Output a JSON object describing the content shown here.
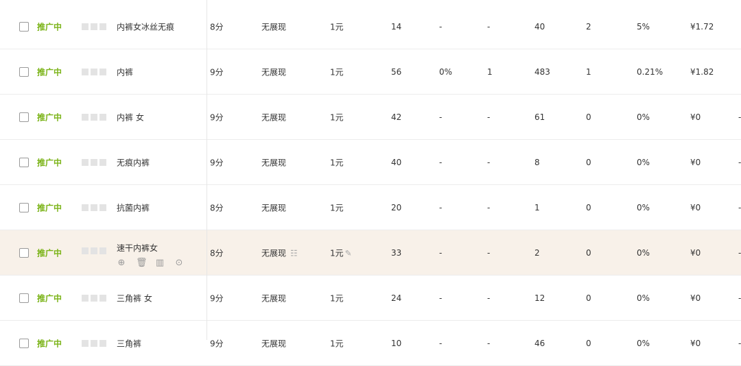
{
  "rows": [
    {
      "status": "推广中",
      "keyword": "内裤女冰丝无痕",
      "score": "8分",
      "show": "无展现",
      "bid": "1元",
      "rank": "14",
      "ctr": "-",
      "clicks": "-",
      "impressions": "40",
      "num": "2",
      "rate": "5%",
      "cost": "¥1.72",
      "extra": ""
    },
    {
      "status": "推广中",
      "keyword": "内裤",
      "score": "9分",
      "show": "无展现",
      "bid": "1元",
      "rank": "56",
      "ctr": "0%",
      "clicks": "1",
      "impressions": "483",
      "num": "1",
      "rate": "0.21%",
      "cost": "¥1.82",
      "extra": ""
    },
    {
      "status": "推广中",
      "keyword": "内裤 女",
      "score": "9分",
      "show": "无展现",
      "bid": "1元",
      "rank": "42",
      "ctr": "-",
      "clicks": "-",
      "impressions": "61",
      "num": "0",
      "rate": "0%",
      "cost": "¥0",
      "extra": "-"
    },
    {
      "status": "推广中",
      "keyword": "无痕内裤",
      "score": "9分",
      "show": "无展现",
      "bid": "1元",
      "rank": "40",
      "ctr": "-",
      "clicks": "-",
      "impressions": "8",
      "num": "0",
      "rate": "0%",
      "cost": "¥0",
      "extra": "-"
    },
    {
      "status": "推广中",
      "keyword": "抗菌内裤",
      "score": "8分",
      "show": "无展现",
      "bid": "1元",
      "rank": "20",
      "ctr": "-",
      "clicks": "-",
      "impressions": "1",
      "num": "0",
      "rate": "0%",
      "cost": "¥0",
      "extra": "-"
    },
    {
      "status": "推广中",
      "keyword": "速干内裤女",
      "score": "8分",
      "show": "无展现",
      "bid": "1元",
      "rank": "33",
      "ctr": "-",
      "clicks": "-",
      "impressions": "2",
      "num": "0",
      "rate": "0%",
      "cost": "¥0",
      "extra": "-"
    },
    {
      "status": "推广中",
      "keyword": "三角裤 女",
      "score": "9分",
      "show": "无展现",
      "bid": "1元",
      "rank": "24",
      "ctr": "-",
      "clicks": "-",
      "impressions": "12",
      "num": "0",
      "rate": "0%",
      "cost": "¥0",
      "extra": "-"
    },
    {
      "status": "推广中",
      "keyword": "三角裤",
      "score": "9分",
      "show": "无展现",
      "bid": "1元",
      "rank": "10",
      "ctr": "-",
      "clicks": "-",
      "impressions": "46",
      "num": "0",
      "rate": "0%",
      "cost": "¥0",
      "extra": "-"
    }
  ],
  "row_actions": {
    "target_icon": "⊕",
    "delete_icon": "🗑",
    "chart_icon": "▥",
    "zoom_icon": "⊙"
  },
  "icons": {
    "list_icon": "☷",
    "edit_icon": "✎"
  },
  "colors": {
    "status_green": "#7ab317",
    "highlight_row": "#f8f1e9"
  }
}
